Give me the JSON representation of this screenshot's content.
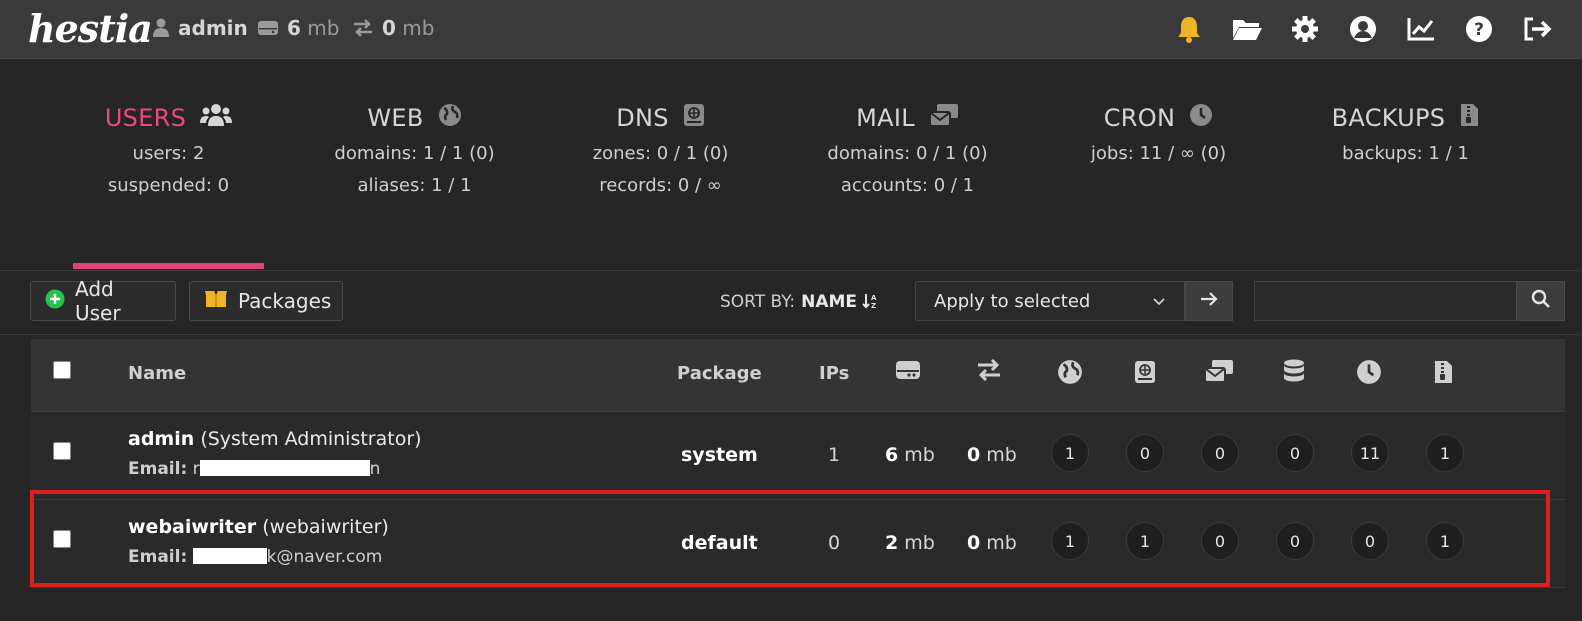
{
  "header": {
    "logo": "hestia",
    "user": "admin",
    "disk_value": "6",
    "disk_unit": "mb",
    "bandwidth_value": "0",
    "bandwidth_unit": "mb",
    "icons": [
      "bell-icon",
      "folder-icon",
      "gear-icon",
      "user-circle-icon",
      "chart-line-icon",
      "question-icon",
      "logout-icon"
    ]
  },
  "tabs": [
    {
      "title": "USERS",
      "icon": "users-icon",
      "lines": [
        "users: 2",
        "suspended: 0"
      ],
      "active": true
    },
    {
      "title": "WEB",
      "icon": "globe-icon",
      "lines": [
        "domains: 1 / 1 (0)",
        "aliases: 1 / 1"
      ]
    },
    {
      "title": "DNS",
      "icon": "dns-book-icon",
      "lines": [
        "zones: 0 / 1 (0)",
        "records: 0 / ∞"
      ]
    },
    {
      "title": "MAIL",
      "icon": "mail-icon",
      "lines": [
        "domains: 0 / 1 (0)",
        "accounts: 0 / 1"
      ]
    },
    {
      "title": "CRON",
      "icon": "clock-icon",
      "lines": [
        "jobs: 11 / ∞ (0)"
      ]
    },
    {
      "title": "BACKUPS",
      "icon": "archive-icon",
      "lines": [
        "backups: 1 / 1"
      ]
    }
  ],
  "toolbar": {
    "add_user": "Add User",
    "packages": "Packages",
    "sort_by_label": "SORT BY:",
    "sort_by_value": "NAME",
    "apply_selected": "Apply to selected",
    "search_placeholder": ""
  },
  "table": {
    "headers": {
      "name": "Name",
      "package": "Package",
      "ips": "IPs"
    },
    "column_icons": [
      "disk-icon",
      "bandwidth-icon",
      "globe-icon",
      "dns-book-icon",
      "mail-icon",
      "database-icon",
      "clock-icon",
      "archive-icon"
    ],
    "rows": [
      {
        "username": "admin",
        "fullname": "(System Administrator)",
        "email_label": "Email:",
        "email_prefix": "r",
        "email_suffix": "n",
        "package": "system",
        "ips": "1",
        "disk_value": "6",
        "disk_unit": "mb",
        "bw_value": "0",
        "bw_unit": "mb",
        "counts": [
          "1",
          "0",
          "0",
          "0",
          "11",
          "1"
        ]
      },
      {
        "username": "webaiwriter",
        "fullname": "(webaiwriter)",
        "email_label": "Email:",
        "email_prefix": "",
        "email_suffix": "k@naver.com",
        "package": "default",
        "ips": "0",
        "disk_value": "2",
        "disk_unit": "mb",
        "bw_value": "0",
        "bw_unit": "mb",
        "counts": [
          "1",
          "1",
          "0",
          "0",
          "0",
          "1"
        ]
      }
    ]
  },
  "colors": {
    "accent": "#e0437c",
    "highlight": "#e01e1e",
    "bell": "#f0b429"
  }
}
